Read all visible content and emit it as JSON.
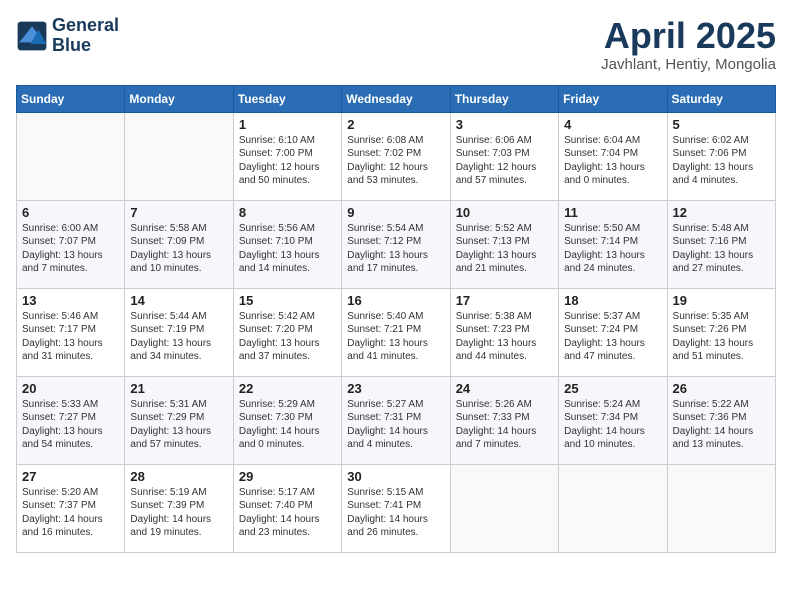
{
  "logo": {
    "line1": "General",
    "line2": "Blue"
  },
  "title": "April 2025",
  "subtitle": "Javhlant, Hentiy, Mongolia",
  "days_of_week": [
    "Sunday",
    "Monday",
    "Tuesday",
    "Wednesday",
    "Thursday",
    "Friday",
    "Saturday"
  ],
  "weeks": [
    [
      {
        "day": "",
        "info": ""
      },
      {
        "day": "",
        "info": ""
      },
      {
        "day": "1",
        "info": "Sunrise: 6:10 AM\nSunset: 7:00 PM\nDaylight: 12 hours\nand 50 minutes."
      },
      {
        "day": "2",
        "info": "Sunrise: 6:08 AM\nSunset: 7:02 PM\nDaylight: 12 hours\nand 53 minutes."
      },
      {
        "day": "3",
        "info": "Sunrise: 6:06 AM\nSunset: 7:03 PM\nDaylight: 12 hours\nand 57 minutes."
      },
      {
        "day": "4",
        "info": "Sunrise: 6:04 AM\nSunset: 7:04 PM\nDaylight: 13 hours\nand 0 minutes."
      },
      {
        "day": "5",
        "info": "Sunrise: 6:02 AM\nSunset: 7:06 PM\nDaylight: 13 hours\nand 4 minutes."
      }
    ],
    [
      {
        "day": "6",
        "info": "Sunrise: 6:00 AM\nSunset: 7:07 PM\nDaylight: 13 hours\nand 7 minutes."
      },
      {
        "day": "7",
        "info": "Sunrise: 5:58 AM\nSunset: 7:09 PM\nDaylight: 13 hours\nand 10 minutes."
      },
      {
        "day": "8",
        "info": "Sunrise: 5:56 AM\nSunset: 7:10 PM\nDaylight: 13 hours\nand 14 minutes."
      },
      {
        "day": "9",
        "info": "Sunrise: 5:54 AM\nSunset: 7:12 PM\nDaylight: 13 hours\nand 17 minutes."
      },
      {
        "day": "10",
        "info": "Sunrise: 5:52 AM\nSunset: 7:13 PM\nDaylight: 13 hours\nand 21 minutes."
      },
      {
        "day": "11",
        "info": "Sunrise: 5:50 AM\nSunset: 7:14 PM\nDaylight: 13 hours\nand 24 minutes."
      },
      {
        "day": "12",
        "info": "Sunrise: 5:48 AM\nSunset: 7:16 PM\nDaylight: 13 hours\nand 27 minutes."
      }
    ],
    [
      {
        "day": "13",
        "info": "Sunrise: 5:46 AM\nSunset: 7:17 PM\nDaylight: 13 hours\nand 31 minutes."
      },
      {
        "day": "14",
        "info": "Sunrise: 5:44 AM\nSunset: 7:19 PM\nDaylight: 13 hours\nand 34 minutes."
      },
      {
        "day": "15",
        "info": "Sunrise: 5:42 AM\nSunset: 7:20 PM\nDaylight: 13 hours\nand 37 minutes."
      },
      {
        "day": "16",
        "info": "Sunrise: 5:40 AM\nSunset: 7:21 PM\nDaylight: 13 hours\nand 41 minutes."
      },
      {
        "day": "17",
        "info": "Sunrise: 5:38 AM\nSunset: 7:23 PM\nDaylight: 13 hours\nand 44 minutes."
      },
      {
        "day": "18",
        "info": "Sunrise: 5:37 AM\nSunset: 7:24 PM\nDaylight: 13 hours\nand 47 minutes."
      },
      {
        "day": "19",
        "info": "Sunrise: 5:35 AM\nSunset: 7:26 PM\nDaylight: 13 hours\nand 51 minutes."
      }
    ],
    [
      {
        "day": "20",
        "info": "Sunrise: 5:33 AM\nSunset: 7:27 PM\nDaylight: 13 hours\nand 54 minutes."
      },
      {
        "day": "21",
        "info": "Sunrise: 5:31 AM\nSunset: 7:29 PM\nDaylight: 13 hours\nand 57 minutes."
      },
      {
        "day": "22",
        "info": "Sunrise: 5:29 AM\nSunset: 7:30 PM\nDaylight: 14 hours\nand 0 minutes."
      },
      {
        "day": "23",
        "info": "Sunrise: 5:27 AM\nSunset: 7:31 PM\nDaylight: 14 hours\nand 4 minutes."
      },
      {
        "day": "24",
        "info": "Sunrise: 5:26 AM\nSunset: 7:33 PM\nDaylight: 14 hours\nand 7 minutes."
      },
      {
        "day": "25",
        "info": "Sunrise: 5:24 AM\nSunset: 7:34 PM\nDaylight: 14 hours\nand 10 minutes."
      },
      {
        "day": "26",
        "info": "Sunrise: 5:22 AM\nSunset: 7:36 PM\nDaylight: 14 hours\nand 13 minutes."
      }
    ],
    [
      {
        "day": "27",
        "info": "Sunrise: 5:20 AM\nSunset: 7:37 PM\nDaylight: 14 hours\nand 16 minutes."
      },
      {
        "day": "28",
        "info": "Sunrise: 5:19 AM\nSunset: 7:39 PM\nDaylight: 14 hours\nand 19 minutes."
      },
      {
        "day": "29",
        "info": "Sunrise: 5:17 AM\nSunset: 7:40 PM\nDaylight: 14 hours\nand 23 minutes."
      },
      {
        "day": "30",
        "info": "Sunrise: 5:15 AM\nSunset: 7:41 PM\nDaylight: 14 hours\nand 26 minutes."
      },
      {
        "day": "",
        "info": ""
      },
      {
        "day": "",
        "info": ""
      },
      {
        "day": "",
        "info": ""
      }
    ]
  ]
}
